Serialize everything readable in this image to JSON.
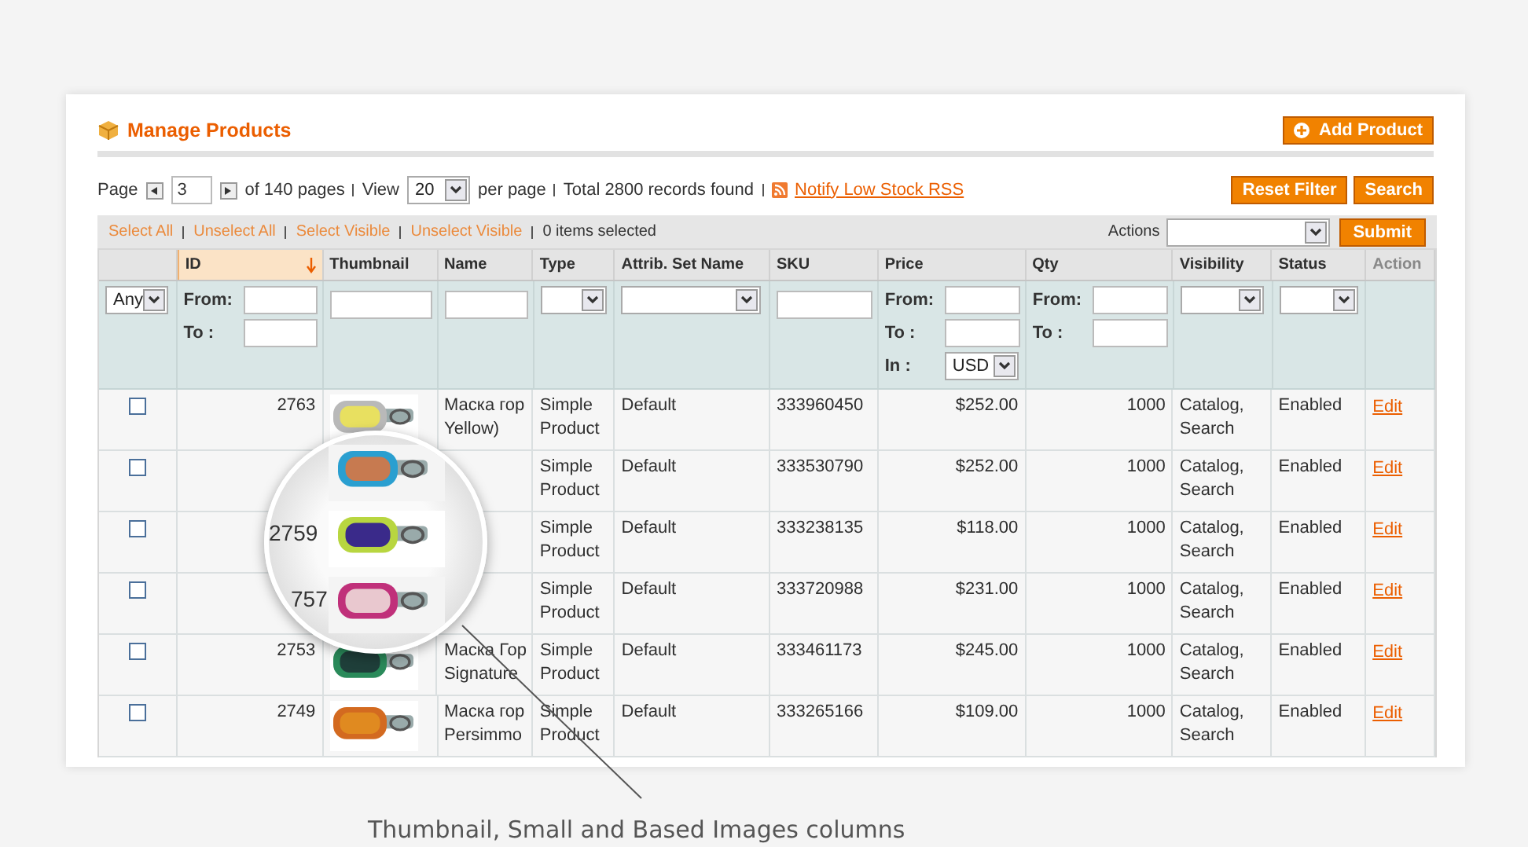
{
  "header": {
    "title": "Manage Products",
    "add_button": "Add Product"
  },
  "pager": {
    "page_label": "Page",
    "page_value": "3",
    "of_pages": "of 140 pages",
    "view_label": "View",
    "view_value": "20",
    "per_page": "per page",
    "total": "Total 2800 records found",
    "rss_link": "Notify Low Stock RSS"
  },
  "filter_buttons": [
    "Reset Filter",
    "Search"
  ],
  "massaction": {
    "links": [
      "Select All",
      "Unselect All",
      "Select Visible",
      "Unselect Visible"
    ],
    "count": "0 items selected",
    "actions_label": "Actions",
    "submit": "Submit"
  },
  "columns": [
    {
      "sorted": false,
      "filter": {
        "kind": "select",
        "value": "Any"
      }
    },
    {
      "label": "ID",
      "sorted": true,
      "sortable": true,
      "filter": {
        "kind": "range",
        "from_label": "From:",
        "to_label": "To :"
      }
    },
    {
      "label": "Thumbnail",
      "sorted": false,
      "sortable": true,
      "filter": {
        "kind": "text"
      }
    },
    {
      "label": "Name",
      "sorted": false,
      "sortable": true,
      "filter": {
        "kind": "text"
      }
    },
    {
      "label": "Type",
      "sorted": false,
      "sortable": true,
      "filter": {
        "kind": "select"
      }
    },
    {
      "label": "Attrib. Set Name",
      "sorted": false,
      "sortable": true,
      "filter": {
        "kind": "select"
      }
    },
    {
      "label": "SKU",
      "sorted": false,
      "sortable": true,
      "filter": {
        "kind": "text"
      }
    },
    {
      "label": "Price",
      "sorted": false,
      "sortable": true,
      "filter": {
        "kind": "range",
        "from_label": "From:",
        "to_label": "To :",
        "currency_label": "In :",
        "currency": "USD"
      }
    },
    {
      "label": "Qty",
      "sorted": false,
      "sortable": true,
      "filter": {
        "kind": "range",
        "from_label": "From:",
        "to_label": "To :"
      }
    },
    {
      "label": "Visibility",
      "sorted": false,
      "sortable": true,
      "filter": {
        "kind": "select"
      }
    },
    {
      "label": "Status",
      "sorted": false,
      "sortable": true,
      "filter": {
        "kind": "select"
      }
    },
    {
      "label": "Action",
      "sorted": false,
      "sortable": false,
      "filter": {
        "kind": "none"
      }
    }
  ],
  "rows": [
    {
      "checked": false,
      "cells": [
        {
          "kind": "checkbox"
        },
        {
          "kind": "text",
          "lines": [
            "2763"
          ]
        },
        {
          "kind": "picture"
        },
        {
          "kind": "text",
          "lines": [
            "Маска гор",
            "Yellow)"
          ]
        },
        {
          "kind": "text",
          "lines": [
            "Simple",
            "Product"
          ]
        },
        {
          "kind": "text",
          "lines": [
            "Default"
          ]
        },
        {
          "kind": "text",
          "lines": [
            "333960450"
          ]
        },
        {
          "kind": "text",
          "lines": [
            "$252.00"
          ]
        },
        {
          "kind": "text",
          "lines": [
            "1000"
          ]
        },
        {
          "kind": "text",
          "lines": [
            "Catalog,",
            "Search"
          ]
        },
        {
          "kind": "text",
          "lines": [
            "Enabled"
          ]
        },
        {
          "kind": "link",
          "lines": [
            "Edit"
          ]
        }
      ]
    },
    {
      "checked": false,
      "cells": [
        {
          "kind": "checkbox"
        },
        {
          "kind": "empty"
        },
        {
          "kind": "empty"
        },
        {
          "kind": "empty"
        },
        {
          "kind": "text",
          "lines": [
            "Simple",
            "Product"
          ]
        },
        {
          "kind": "text",
          "lines": [
            "Default"
          ]
        },
        {
          "kind": "text",
          "lines": [
            "333530790"
          ]
        },
        {
          "kind": "text",
          "lines": [
            "$252.00"
          ]
        },
        {
          "kind": "text",
          "lines": [
            "1000"
          ]
        },
        {
          "kind": "text",
          "lines": [
            "Catalog,",
            "Search"
          ]
        },
        {
          "kind": "text",
          "lines": [
            "Enabled"
          ]
        },
        {
          "kind": "link",
          "lines": [
            "Edit"
          ]
        }
      ]
    },
    {
      "checked": false,
      "cells": [
        {
          "kind": "checkbox"
        },
        {
          "kind": "empty"
        },
        {
          "kind": "empty"
        },
        {
          "kind": "empty"
        },
        {
          "kind": "text",
          "lines": [
            "Simple",
            "Product"
          ]
        },
        {
          "kind": "text",
          "lines": [
            "Default"
          ]
        },
        {
          "kind": "text",
          "lines": [
            "333238135"
          ]
        },
        {
          "kind": "text",
          "lines": [
            "$118.00"
          ]
        },
        {
          "kind": "text",
          "lines": [
            "1000"
          ]
        },
        {
          "kind": "text",
          "lines": [
            "Catalog,",
            "Search"
          ]
        },
        {
          "kind": "text",
          "lines": [
            "Enabled"
          ]
        },
        {
          "kind": "link",
          "lines": [
            "Edit"
          ]
        }
      ]
    },
    {
      "checked": false,
      "cells": [
        {
          "kind": "checkbox"
        },
        {
          "kind": "empty"
        },
        {
          "kind": "empty"
        },
        {
          "kind": "empty"
        },
        {
          "kind": "text",
          "lines": [
            "Simple",
            "Product"
          ]
        },
        {
          "kind": "text",
          "lines": [
            "Default"
          ]
        },
        {
          "kind": "text",
          "lines": [
            "333720988"
          ]
        },
        {
          "kind": "text",
          "lines": [
            "$231.00"
          ]
        },
        {
          "kind": "text",
          "lines": [
            "1000"
          ]
        },
        {
          "kind": "text",
          "lines": [
            "Catalog,",
            "Search"
          ]
        },
        {
          "kind": "text",
          "lines": [
            "Enabled"
          ]
        },
        {
          "kind": "link",
          "lines": [
            "Edit"
          ]
        }
      ]
    },
    {
      "checked": false,
      "cells": [
        {
          "kind": "checkbox"
        },
        {
          "kind": "text",
          "lines": [
            "2753"
          ]
        },
        {
          "kind": "picture"
        },
        {
          "kind": "text",
          "lines": [
            "Маска Гор",
            "Signature"
          ]
        },
        {
          "kind": "text",
          "lines": [
            "Simple",
            "Product"
          ]
        },
        {
          "kind": "text",
          "lines": [
            "Default"
          ]
        },
        {
          "kind": "text",
          "lines": [
            "333461173"
          ]
        },
        {
          "kind": "text",
          "lines": [
            "$245.00"
          ]
        },
        {
          "kind": "text",
          "lines": [
            "1000"
          ]
        },
        {
          "kind": "text",
          "lines": [
            "Catalog,",
            "Search"
          ]
        },
        {
          "kind": "text",
          "lines": [
            "Enabled"
          ]
        },
        {
          "kind": "link",
          "lines": [
            "Edit"
          ]
        }
      ]
    },
    {
      "checked": false,
      "cells": [
        {
          "kind": "checkbox"
        },
        {
          "kind": "text",
          "lines": [
            "2749"
          ]
        },
        {
          "kind": "picture"
        },
        {
          "kind": "text",
          "lines": [
            "Маска гор",
            "Persimmo"
          ]
        },
        {
          "kind": "text",
          "lines": [
            "Simple",
            "Product"
          ]
        },
        {
          "kind": "text",
          "lines": [
            "Default"
          ]
        },
        {
          "kind": "text",
          "lines": [
            "333265166"
          ]
        },
        {
          "kind": "text",
          "lines": [
            "$109.00"
          ]
        },
        {
          "kind": "text",
          "lines": [
            "1000"
          ]
        },
        {
          "kind": "text",
          "lines": [
            "Catalog,",
            "Search"
          ]
        },
        {
          "kind": "text",
          "lines": [
            "Enabled"
          ]
        },
        {
          "kind": "link",
          "lines": [
            "Edit"
          ]
        }
      ]
    }
  ],
  "magnifier": {
    "labels": [
      "2759",
      "757"
    ]
  },
  "caption": "Thumbnail, Small and Based Images columns"
}
